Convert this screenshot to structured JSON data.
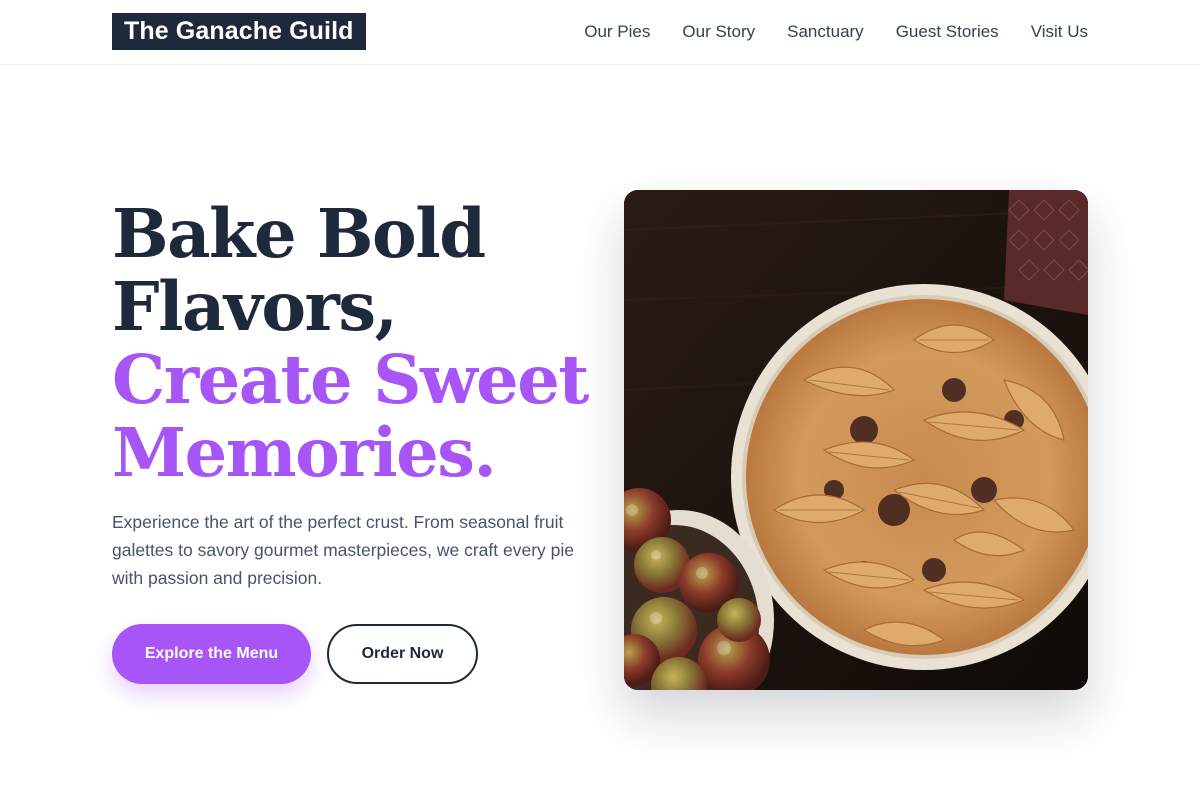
{
  "header": {
    "logo": "The Ganache Guild",
    "nav": [
      {
        "label": "Our Pies"
      },
      {
        "label": "Our Story"
      },
      {
        "label": "Sanctuary"
      },
      {
        "label": "Guest Stories"
      },
      {
        "label": "Visit Us"
      }
    ]
  },
  "hero": {
    "title_line1": "Bake Bold",
    "title_line2": "Flavors,",
    "title_accent_line1": "Create Sweet",
    "title_accent_line2": "Memories.",
    "description": "Experience the art of the perfect crust. From seasonal fruit galettes to savory gourmet masterpieces, we craft every pie with passion and precision.",
    "primary_button": "Explore the Menu",
    "secondary_button": "Order Now",
    "image_subject": "lattice-leaf-pie-with-apples-photo"
  },
  "colors": {
    "brand_dark": "#1e293b",
    "accent": "#a855f7",
    "body_text": "#475569",
    "nav_text": "#334155"
  }
}
